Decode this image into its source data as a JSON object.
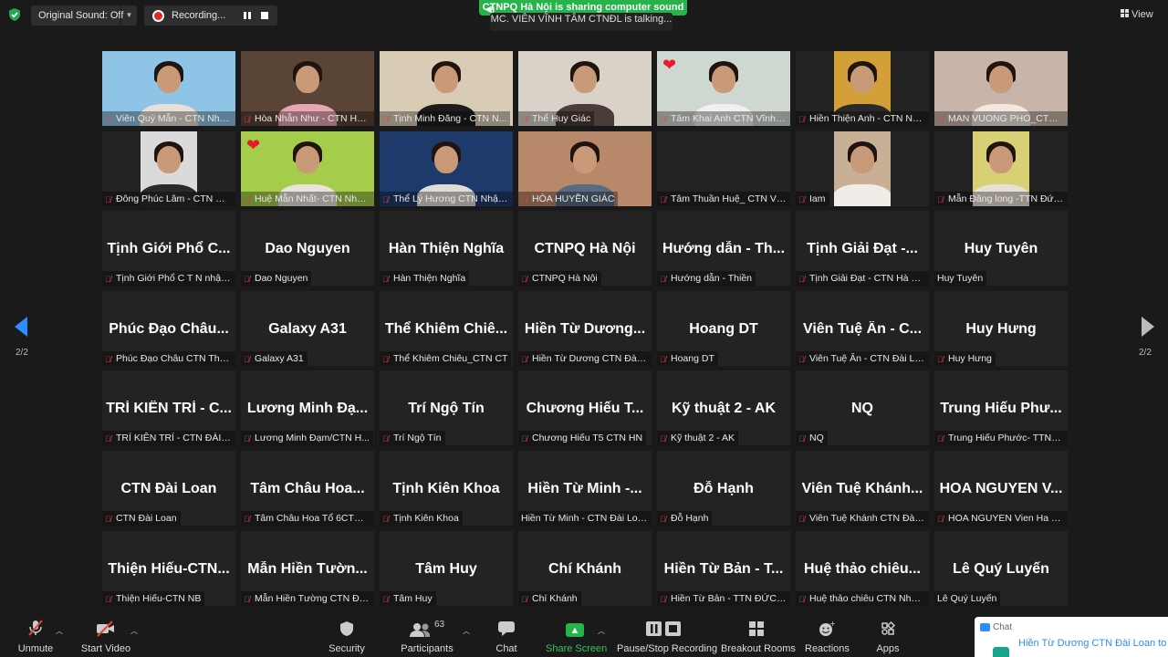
{
  "topbar": {
    "original_sound": "Original Sound: Off",
    "recording": "Recording...",
    "share_banner": "CTNPQ Hà Nội is sharing computer sound",
    "talking": "MC. VIÊN VĨNH TÂM CTNĐL is talking...",
    "view": "View"
  },
  "nav": {
    "page_left": "2/2",
    "page_right": "2/2"
  },
  "video_tiles": [
    {
      "label": "Viên Quý Mẫn - CTN Nhật...",
      "bg": "#8ec4e6",
      "shirt": "#e8e0d8",
      "heart": false
    },
    {
      "label": "Hòa Nhẫn Như - CTN Hà ...",
      "bg": "#5a4436",
      "shirt": "#e6a6b4",
      "heart": false
    },
    {
      "label": "Tịnh Minh Đăng - CTN N...",
      "bg": "#d9ccb4",
      "shirt": "#1c1c1c",
      "heart": false
    },
    {
      "label": "Thể Huy Giác",
      "bg": "#d8d2c8",
      "shirt": "#4a3c36",
      "heart": false
    },
    {
      "label": "Tâm Khai Anh CTN Vĩnh P...",
      "bg": "#cfd8d0",
      "shirt": "#f0f0f0",
      "heart": true
    },
    {
      "label": "Hiền Thiện Anh - CTN Nh...",
      "bg": "#d2a036",
      "shirt": "#2a2a2a",
      "heart": false,
      "inset": true
    },
    {
      "label": "MAN VUONG PHO_CTN ...",
      "bg": "#c8b4a8",
      "shirt": "#f2e8e0",
      "heart": false
    },
    {
      "label": "Đông Phúc Lâm - CTN Hà...",
      "bg": "#dadada",
      "shirt": "#2a2a2a",
      "heart": false,
      "inset": true
    },
    {
      "label": "Huệ Mẫn Nhất- CTN Nhật...",
      "bg": "#a6cc4c",
      "shirt": "#e8e4dc",
      "heart": true
    },
    {
      "label": "Thể Lý Hương CTN Nhật ...",
      "bg": "#1e3a6a",
      "shirt": "#e0dcd8",
      "heart": false
    },
    {
      "label": "HÒA HUYỀN GIÁC",
      "bg": "#b8886a",
      "shirt": "#5a6a80",
      "heart": false
    }
  ],
  "tile_tam_thuan": {
    "label": "Tâm Thuần Huệ_ CTN Vĩn..."
  },
  "tile_iam": {
    "label": "Iam",
    "bg": "#c8b096",
    "shirt": "#f0ece8"
  },
  "tile_man_dang": {
    "label": "Mẫn Đăng long -TTN Đức...",
    "bg": "#d8d074",
    "shirt": "#e8e0d4"
  },
  "name_tiles": [
    {
      "name": "Tịnh Giới Phổ C...",
      "label": "Tịnh Giới Phổ C T N nhật ...",
      "muted": true
    },
    {
      "name": "Dao Nguyen",
      "label": "Dao Nguyen",
      "muted": true
    },
    {
      "name": "Hàn Thiện Nghĩa",
      "label": "Hàn Thiện Nghĩa",
      "muted": true
    },
    {
      "name": "CTNPQ Hà Nội",
      "label": "CTNPQ Hà Nội",
      "muted": true
    },
    {
      "name": "Hướng dẫn - Th...",
      "label": "Hướng dẫn - Thiền",
      "muted": true
    },
    {
      "name": "Tịnh Giải Đạt -...",
      "label": "Tịnh Giải Đạt - CTN Hà Nội",
      "muted": true
    },
    {
      "name": "Huy Tuyên",
      "label": "Huy Tuyên",
      "muted": false
    },
    {
      "name": "Phúc Đạo Châu...",
      "label": "Phúc Đạo Châu CTN Than...",
      "muted": true
    },
    {
      "name": "Galaxy A31",
      "label": "Galaxy A31",
      "muted": true
    },
    {
      "name": "Thể Khiêm Chiê...",
      "label": "Thể Khiêm Chiêu_CTN CT",
      "muted": true
    },
    {
      "name": "Hiền Từ Dương...",
      "label": "Hiền Từ Dương CTN Đài L...",
      "muted": true
    },
    {
      "name": "Hoang DT",
      "label": "Hoang DT",
      "muted": true
    },
    {
      "name": "Viên Tuệ Ân - C...",
      "label": "Viên Tuệ Ân - CTN Đài Lo...",
      "muted": true
    },
    {
      "name": "Huy Hưng",
      "label": "Huy Hưng",
      "muted": true
    },
    {
      "name": "TRÍ KIÊN TRÍ - C...",
      "label": "TRÍ KIÊN TRÍ - CTN ĐÀI L...",
      "muted": true
    },
    {
      "name": "Lương Minh Đạ...",
      "label": "Lương Minh Đạm/CTN H...",
      "muted": true
    },
    {
      "name": "Trí Ngộ Tín",
      "label": "Trí Ngộ Tín",
      "muted": true
    },
    {
      "name": "Chương Hiếu T...",
      "label": "Chương Hiếu T5 CTN HN",
      "muted": true
    },
    {
      "name": "Kỹ thuật 2 - AK",
      "label": "Kỹ thuật 2 - AK",
      "muted": true
    },
    {
      "name": "NQ",
      "label": "NQ",
      "muted": true
    },
    {
      "name": "Trung Hiếu Phư...",
      "label": "Trung Hiếu Phước- TTNP...",
      "muted": true
    },
    {
      "name": "CTN Đài Loan",
      "label": "CTN Đài Loan",
      "muted": true
    },
    {
      "name": "Tâm Châu Hoa...",
      "label": "Tâm Châu Hoa Tổ 6CTN.H...",
      "muted": true
    },
    {
      "name": "Tịnh Kiên Khoa",
      "label": "Tịnh Kiên Khoa",
      "muted": true
    },
    {
      "name": "Hiền Từ Minh -...",
      "label": "Hiền Từ Minh - CTN Đài Loan",
      "muted": false
    },
    {
      "name": "Đỗ Hạnh",
      "label": "Đỗ Hạnh",
      "muted": true
    },
    {
      "name": "Viên Tuệ Khánh...",
      "label": "Viên Tuệ Khánh CTN Đài ...",
      "muted": true
    },
    {
      "name": "HOA NGUYEN V...",
      "label": "HOA NGUYEN Vien Ha C...",
      "muted": true
    },
    {
      "name": "Thiện Hiếu-CTN...",
      "label": "Thiện Hiếu-CTN NB",
      "muted": true
    },
    {
      "name": "Mẫn Hiền Tườn...",
      "label": "Mẫn Hiền Tường CTN Đài...",
      "muted": true
    },
    {
      "name": "Tâm Huy",
      "label": "Tâm Huy",
      "muted": true
    },
    {
      "name": "Chí Khánh",
      "label": "Chí Khánh",
      "muted": true
    },
    {
      "name": "Hiền Từ Bản - T...",
      "label": "Hiền Từ Bản - TTN ĐỨC N...",
      "muted": true
    },
    {
      "name": "Huệ thảo chiêu...",
      "label": "Huệ thảo chiêu CTN Nhật...",
      "muted": true
    },
    {
      "name": "Lê Quý Luyến",
      "label": "Lê Quý Luyến",
      "muted": false
    }
  ],
  "toolbar": {
    "unmute": "Unmute",
    "start_video": "Start Video",
    "security": "Security",
    "participants": "Participants",
    "participants_count": "63",
    "chat": "Chat",
    "share_screen": "Share Screen",
    "pause_stop_recording": "Pause/Stop Recording",
    "breakout_rooms": "Breakout Rooms",
    "reactions": "Reactions",
    "apps": "Apps"
  },
  "chat_popup": {
    "title": "Chat",
    "message": "Hiền Từ Dương CTN Đài Loan to Everyone"
  },
  "colors": {
    "accent_green": "#26b34a",
    "accent_blue": "#2d8cff",
    "muted_red": "#e0463c"
  }
}
